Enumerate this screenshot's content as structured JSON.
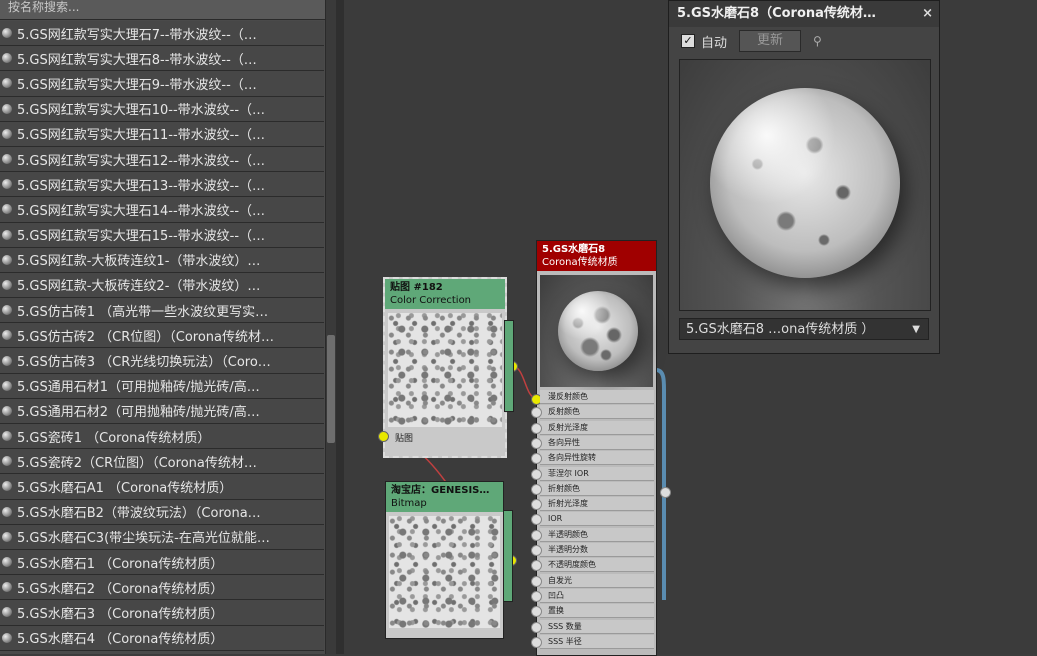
{
  "search": {
    "placeholder": "按名称搜索..."
  },
  "material_list": [
    "5.GS网红款写实大理石7--带水波纹--（…",
    "5.GS网红款写实大理石8--带水波纹--（…",
    "5.GS网红款写实大理石9--带水波纹--（…",
    "5.GS网红款写实大理石10--带水波纹--（…",
    "5.GS网红款写实大理石11--带水波纹--（…",
    "5.GS网红款写实大理石12--带水波纹--（…",
    "5.GS网红款写实大理石13--带水波纹--（…",
    "5.GS网红款写实大理石14--带水波纹--（…",
    "5.GS网红款写实大理石15--带水波纹--（…",
    "5.GS网红款-大板砖连纹1-（带水波纹）…",
    "5.GS网红款-大板砖连纹2-（带水波纹）…",
    "5.GS仿古砖1 （高光带一些水波纹更写实…",
    "5.GS仿古砖2 （CR位图）（Corona传统材…",
    "5.GS仿古砖3 （CR光线切换玩法）（Coro…",
    "5.GS通用石材1（可用抛釉砖/抛光砖/高…",
    "5.GS通用石材2（可用抛釉砖/抛光砖/高…",
    "5.GS瓷砖1 （Corona传统材质）",
    "5.GS瓷砖2（CR位图）（Corona传统材…",
    "5.GS水磨石A1 （Corona传统材质）",
    "5.GS水磨石B2（带波纹玩法）（Corona…",
    "5.GS水磨石C3(带尘埃玩法-在高光位就能…",
    "5.GS水磨石1 （Corona传统材质）",
    "5.GS水磨石2 （Corona传统材质）",
    "5.GS水磨石3 （Corona传统材质）",
    "5.GS水磨石4 （Corona传统材质）"
  ],
  "nodes": {
    "color_correction": {
      "title": "贴图 #182",
      "subtitle": "Color Correction",
      "port_label": "贴图"
    },
    "bitmap": {
      "title": "淘宝店：GENESIS…",
      "subtitle": "Bitmap"
    },
    "material": {
      "title": "5.GS水磨石8",
      "subtitle": "Corona传统材质",
      "slots": [
        "漫反射颜色",
        "反射颜色",
        "反射光泽度",
        "各向异性",
        "各向异性旋转",
        "菲涅尔 IOR",
        "折射颜色",
        "折射光泽度",
        "IOR",
        "半透明颜色",
        "半透明分数",
        "不透明度颜色",
        "自发光",
        "凹凸",
        "置换",
        "SSS 数量",
        "SSS 半径"
      ]
    }
  },
  "preview_window": {
    "title": "5.GS水磨石8（Corona传统材…",
    "close": "×",
    "auto_label": "自动",
    "auto_checked": "✓",
    "update_label": "更新",
    "pin_icon": "⚲",
    "dropdown_value": "5.GS水磨石8 …ona传统材质 ）",
    "dropdown_arrow": "▼"
  },
  "colors": {
    "material_header": "#a00000",
    "map_header": "#5fa878",
    "port": "#e8e800",
    "wire": "#c04040"
  }
}
